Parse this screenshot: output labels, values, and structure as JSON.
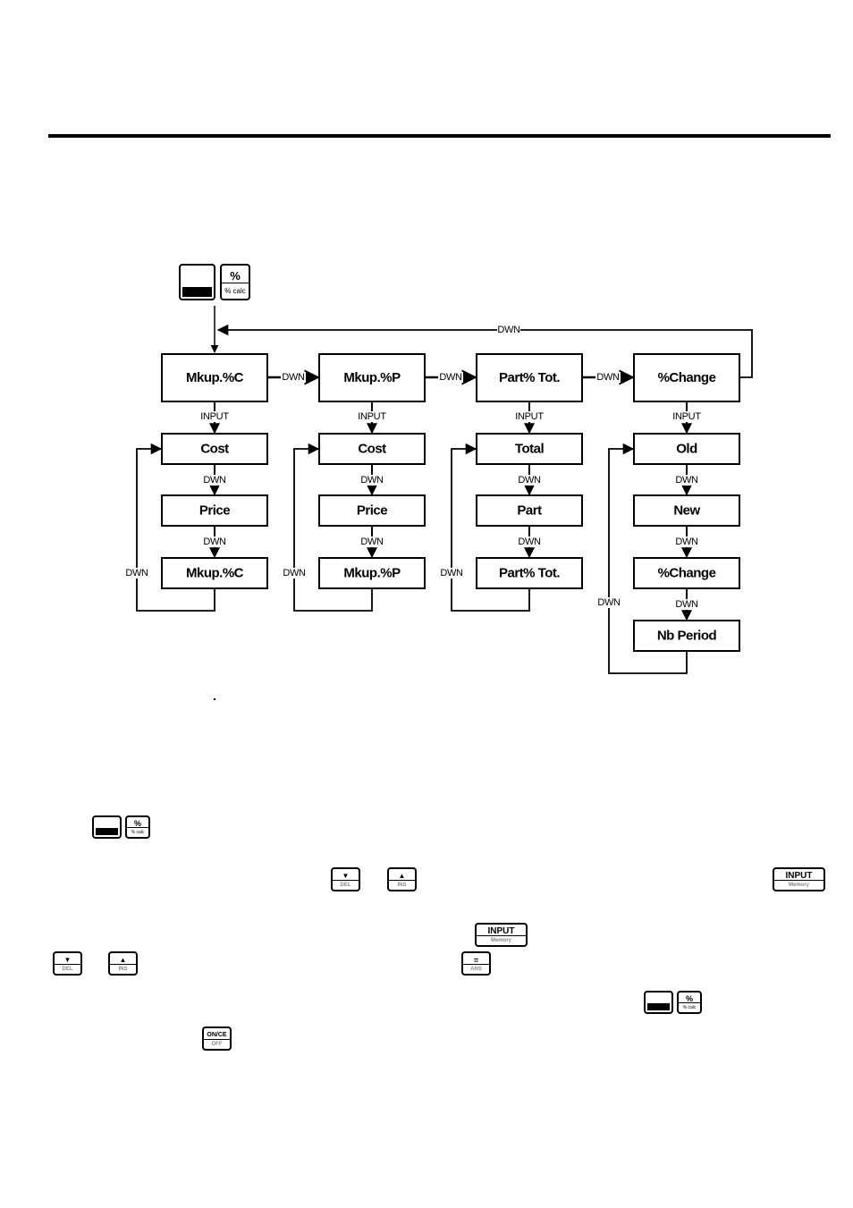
{
  "page": {
    "header_rule": true
  },
  "keys": {
    "shift": {
      "name": "shift-key",
      "top_label": "",
      "bottom_label": ""
    },
    "percent": {
      "name": "percent-key",
      "top_label": "%",
      "bottom_label": "% calc"
    },
    "down": {
      "top_label": "▼",
      "bottom_label": "DEL"
    },
    "up": {
      "top_label": "▲",
      "bottom_label": "INS"
    },
    "input": {
      "top_label": "INPUT",
      "bottom_label": "Memory"
    },
    "equals": {
      "top_label": "=",
      "bottom_label": "ANS"
    },
    "onoff": {
      "top_label": "ON/CE",
      "bottom_label": "OFF"
    }
  },
  "diagram": {
    "loop_label": "DWN",
    "menus": [
      {
        "title": "Mkup.%C",
        "next_label": "DWN",
        "input_label": "INPUT",
        "loop_label": "DWN",
        "steps": [
          "Cost",
          "Price",
          "Mkup.%C"
        ],
        "step_labels": [
          "DWN",
          "DWN"
        ]
      },
      {
        "title": "Mkup.%P",
        "next_label": "DWN",
        "input_label": "INPUT",
        "loop_label": "DWN",
        "steps": [
          "Cost",
          "Price",
          "Mkup.%P"
        ],
        "step_labels": [
          "DWN",
          "DWN"
        ]
      },
      {
        "title": "Part% Tot.",
        "next_label": "DWN",
        "input_label": "INPUT",
        "loop_label": "DWN",
        "steps": [
          "Total",
          "Part",
          "Part% Tot."
        ],
        "step_labels": [
          "DWN",
          "DWN"
        ]
      },
      {
        "title": "%Change",
        "next_label": "",
        "input_label": "INPUT",
        "loop_label": "DWN",
        "steps": [
          "Old",
          "New",
          "%Change",
          "Nb  Period"
        ],
        "step_labels": [
          "DWN",
          "DWN",
          "DWN"
        ]
      }
    ]
  }
}
